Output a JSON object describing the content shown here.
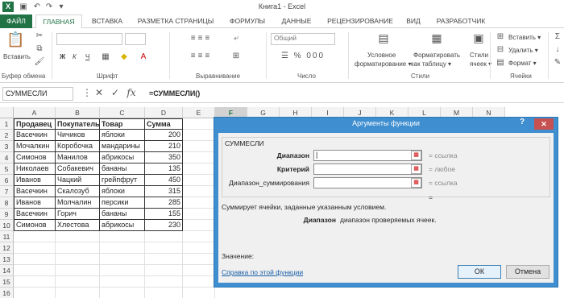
{
  "window": {
    "title": "Книга1 - Excel"
  },
  "ribbon": {
    "tabs": [
      "ФАЙЛ",
      "ГЛАВНАЯ",
      "ВСТАВКА",
      "РАЗМЕТКА СТРАНИЦЫ",
      "ФОРМУЛЫ",
      "ДАННЫЕ",
      "РЕЦЕНЗИРОВАНИЕ",
      "ВИД",
      "РАЗРАБОТЧИК"
    ],
    "paste_label": "Вставить",
    "number_format": "Общий",
    "cond_format": [
      "Условное",
      "форматирование ▾"
    ],
    "format_table": [
      "Форматировать",
      "как таблицу ▾"
    ],
    "cell_styles": [
      "Стили",
      "ячеек ▾"
    ],
    "cells_buttons": [
      "Вставить ▾",
      "Удалить ▾",
      "Формат ▾"
    ],
    "groups": [
      "Буфер обмена",
      "Шрифт",
      "Выравнивание",
      "Число",
      "Стили",
      "Ячейки"
    ],
    "font_buttons": [
      "Ж",
      "К",
      "Ч"
    ]
  },
  "formula_bar": {
    "name_box": "СУММЕСЛИ",
    "formula": "=СУММЕСЛИ()"
  },
  "sheet": {
    "columns": [
      "A",
      "B",
      "C",
      "D",
      "E",
      "F",
      "G",
      "H",
      "I",
      "J",
      "K",
      "L",
      "M",
      "N"
    ],
    "rows": [
      "1",
      "2",
      "3",
      "4",
      "5",
      "6",
      "7",
      "8",
      "9",
      "10",
      "11",
      "12",
      "13",
      "14",
      "15",
      "16"
    ],
    "headers": [
      "Продавец",
      "Покупатель",
      "Товар",
      "Сумма"
    ],
    "data": [
      [
        "Васечкин",
        "Чичиков",
        "яблоки",
        "200"
      ],
      [
        "Мочалкин",
        "Коробочка",
        "мандарины",
        "210"
      ],
      [
        "Симонов",
        "Манилов",
        "абрикосы",
        "350"
      ],
      [
        "Николаев",
        "Собакевич",
        "бананы",
        "135"
      ],
      [
        "Иванов",
        "Чацкий",
        "грейпфрут",
        "450"
      ],
      [
        "Васечкин",
        "Скалозуб",
        "яблоки",
        "315"
      ],
      [
        "Иванов",
        "Молчалин",
        "персики",
        "285"
      ],
      [
        "Васечкин",
        "Горич",
        "бананы",
        "155"
      ],
      [
        "Симонов",
        "Хлестова",
        "абрикосы",
        "230"
      ]
    ]
  },
  "dialog": {
    "title": "Аргументы функции",
    "help": "?",
    "close": "✕",
    "function_name": "СУММЕСЛИ",
    "args": [
      {
        "label": "Диапазон",
        "hint": "ссылка",
        "bold": true
      },
      {
        "label": "Критерий",
        "hint": "любое",
        "bold": true
      },
      {
        "label": "Диапазон_суммирования",
        "hint": "ссылка",
        "bold": false
      }
    ],
    "eq": "=",
    "description": "Суммирует ячейки, заданные указанным условием.",
    "arg_name": "Диапазон",
    "arg_desc": "диапазон проверяемых ячеек.",
    "value_label": "Значение:",
    "help_link": "Справка по этой функции",
    "ok": "ОК",
    "cancel": "Отмена"
  }
}
